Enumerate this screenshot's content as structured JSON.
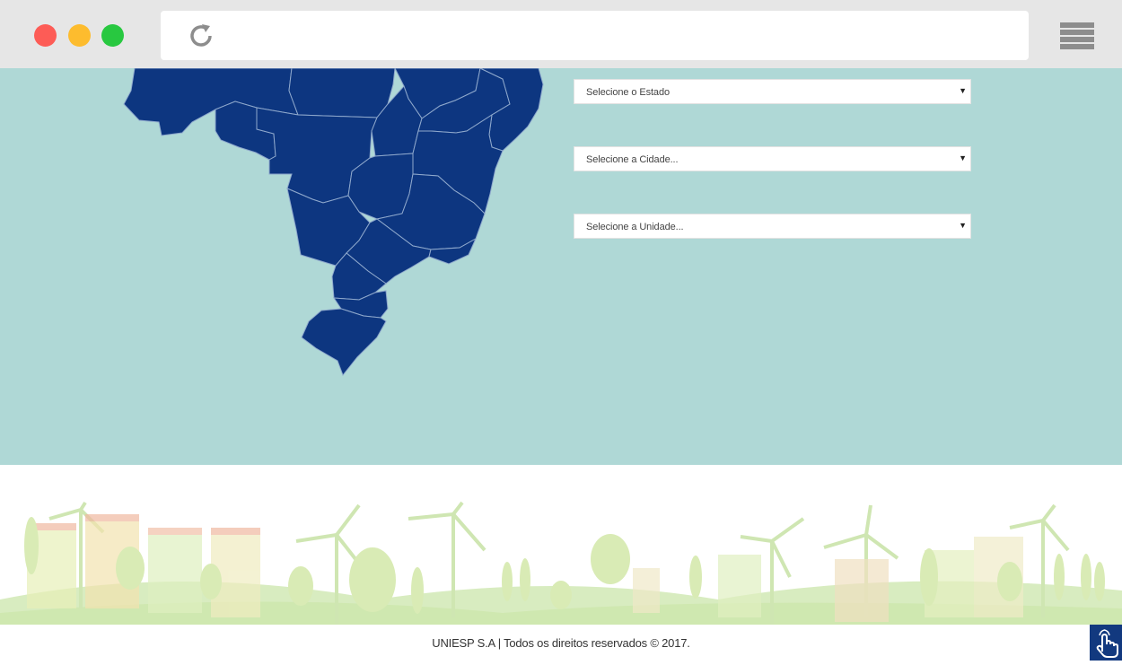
{
  "browser": {
    "window_controls": [
      "close",
      "minimize",
      "maximize"
    ],
    "reload_icon": "reload-icon",
    "menu_icon": "hamburger-menu-icon"
  },
  "colors": {
    "background": "#afd8d6",
    "map": "#0d3680",
    "accent_button": "#12397f"
  },
  "selects": [
    {
      "placeholder": "Selecione o Estado"
    },
    {
      "placeholder": "Selecione a Cidade..."
    },
    {
      "placeholder": "Selecione a Unidade..."
    }
  ],
  "footer": {
    "copyright": "UNIESP S.A | Todos os direitos reservados © 2017.",
    "floating_icon": "pointer-hand-icon"
  }
}
